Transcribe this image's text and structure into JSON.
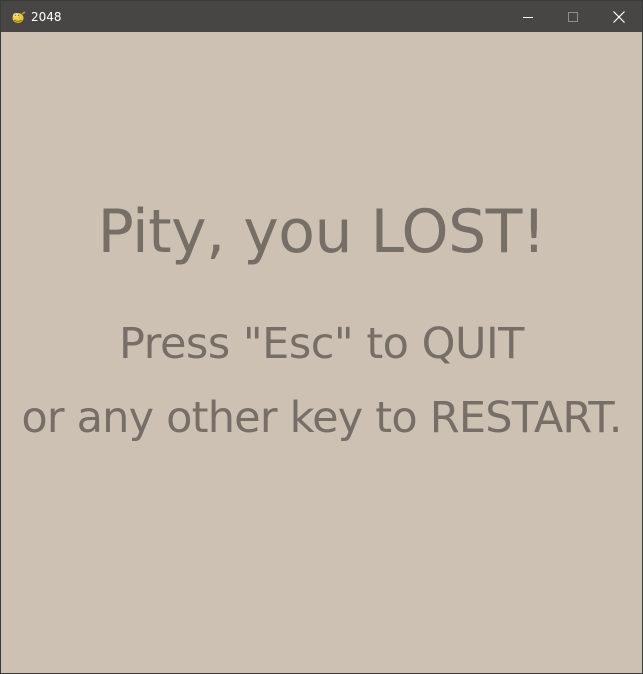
{
  "window": {
    "title": "2048",
    "icon": "python-snake-icon",
    "controls": {
      "minimize": "minimize-icon",
      "maximize": "maximize-icon",
      "close": "close-icon"
    }
  },
  "game_over": {
    "title": "Pity, you LOST!",
    "line1": "Press \"Esc\" to QUIT",
    "line2": "or any other key to RESTART."
  },
  "colors": {
    "titlebar": "#474645",
    "background": "#cdc1b4",
    "text": "#776e65"
  }
}
